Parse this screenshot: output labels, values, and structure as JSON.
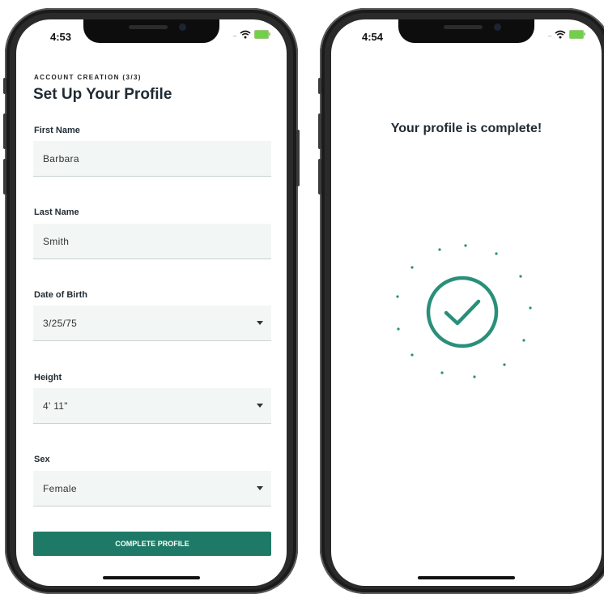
{
  "left_screen": {
    "status_time": "4:53",
    "eyebrow": "ACCOUNT CREATION (3/3)",
    "title": "Set Up Your Profile",
    "fields": [
      {
        "label": "First Name",
        "value": "Barbara",
        "dropdown": false
      },
      {
        "label": "Last Name",
        "value": "Smith",
        "dropdown": false
      },
      {
        "label": "Date of Birth",
        "value": "3/25/75",
        "dropdown": true
      },
      {
        "label": "Height",
        "value": "4' 11\"",
        "dropdown": true
      },
      {
        "label": "Sex",
        "value": "Female",
        "dropdown": true
      }
    ],
    "submit_label": "COMPLETE PROFILE"
  },
  "right_screen": {
    "status_time": "4:54",
    "title": "Your profile is complete!",
    "icon": "checkmark-circle-icon"
  },
  "colors": {
    "accent": "#1e7a66",
    "check": "#2a8f7a",
    "field_bg": "#f2f6f4",
    "text": "#1f2a33"
  }
}
